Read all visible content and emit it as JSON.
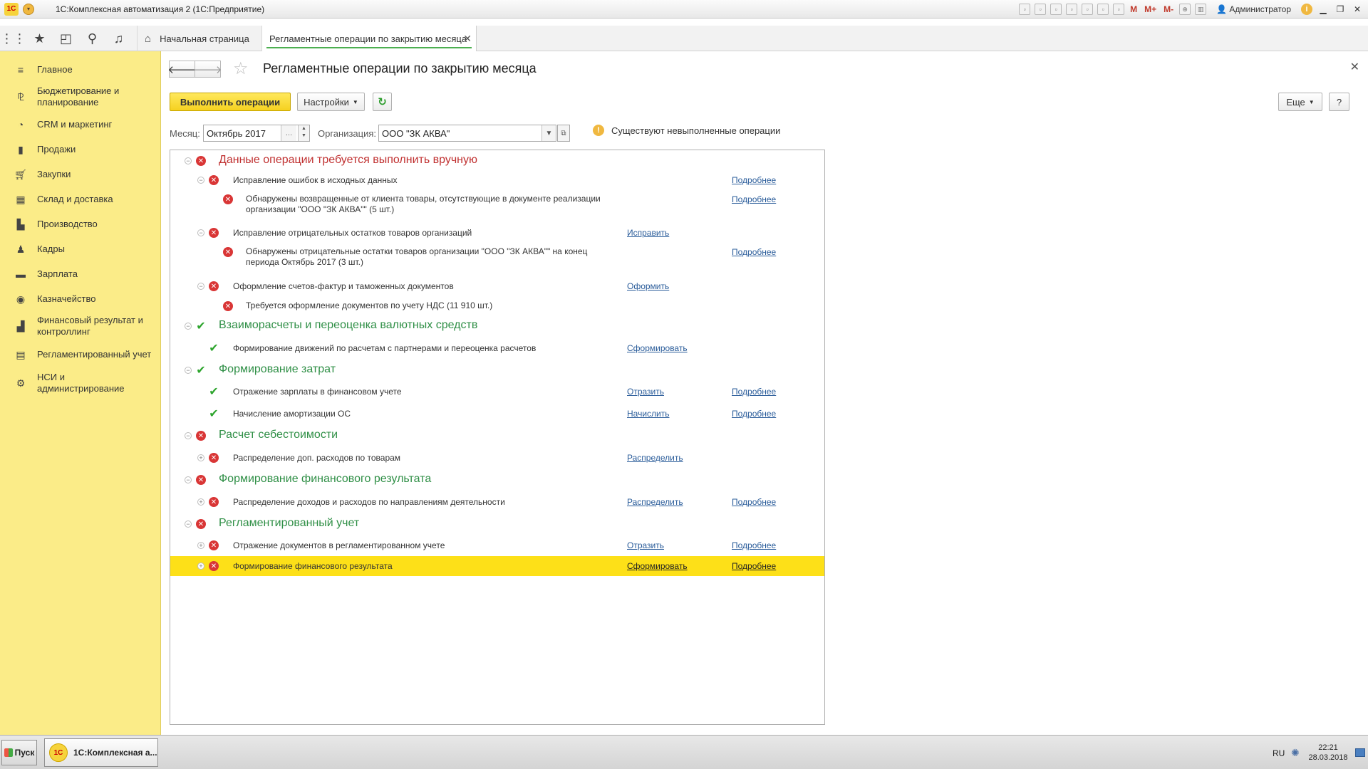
{
  "window": {
    "logo": "1С",
    "title": "1С:Комплексная автоматизация 2  (1С:Предприятие)",
    "user": "Администратор",
    "toolbar_m": [
      "M",
      "M+",
      "M-"
    ]
  },
  "nav": {
    "icons": [
      "apps-grid-icon",
      "star-icon",
      "history-icon",
      "search-icon",
      "bell-icon"
    ],
    "home_tab": "Начальная страница",
    "active_tab": "Регламентные операции по закрытию месяца"
  },
  "sidebar": {
    "items": [
      {
        "label": "Главное",
        "icon": "menu-icon"
      },
      {
        "label": "Бюджетирование и планирование",
        "icon": "budget-icon"
      },
      {
        "label": "CRM и маркетинг",
        "icon": "crm-icon"
      },
      {
        "label": "Продажи",
        "icon": "sales-icon"
      },
      {
        "label": "Закупки",
        "icon": "cart-icon"
      },
      {
        "label": "Склад и доставка",
        "icon": "warehouse-icon"
      },
      {
        "label": "Производство",
        "icon": "production-icon"
      },
      {
        "label": "Кадры",
        "icon": "person-icon"
      },
      {
        "label": "Зарплата",
        "icon": "salary-icon"
      },
      {
        "label": "Казначейство",
        "icon": "treasury-icon"
      },
      {
        "label": "Финансовый результат и контроллинг",
        "icon": "chart-icon"
      },
      {
        "label": "Регламентированный учет",
        "icon": "ledger-icon"
      },
      {
        "label": "НСИ и администрирование",
        "icon": "gear-icon"
      }
    ]
  },
  "form": {
    "title": "Регламентные операции по закрытию месяца",
    "execute_label": "Выполнить операции",
    "settings_label": "Настройки",
    "more_label": "Еще",
    "help_label": "?",
    "month_label": "Месяц:",
    "month_value": "Октябрь 2017",
    "org_label": "Организация:",
    "org_value": "ООО \"ЗК АКВА\"",
    "warning_text": "Существуют невыполненные операции"
  },
  "tree": {
    "rows": [
      {
        "level": 1,
        "status": "error",
        "toggle": "collapse",
        "text": "Данные операции требуется выполнить вручную",
        "color": "red"
      },
      {
        "level": 2,
        "status": "error",
        "toggle": "collapse",
        "text": "Исправление ошибок в исходных данных",
        "action": "",
        "details": "Подробнее"
      },
      {
        "level": 3,
        "status": "error",
        "text": "Обнаружены возвращенные от клиента товары, отсутствующие в документе реализации организации \"ООО \"ЗК АКВА\"\" (5 шт.)",
        "action": "",
        "details": "Подробнее"
      },
      {
        "level": 2,
        "status": "error",
        "toggle": "collapse",
        "text": "Исправление отрицательных остатков товаров организаций",
        "action": "Исправить",
        "details": ""
      },
      {
        "level": 3,
        "status": "error",
        "text": "Обнаружены отрицательные остатки товаров организации \"ООО \"ЗК АКВА\"\" на конец периода Октябрь 2017 (3 шт.)",
        "action": "",
        "details": "Подробнее"
      },
      {
        "level": 2,
        "status": "error",
        "toggle": "collapse",
        "text": "Оформление счетов-фактур и таможенных документов",
        "action": "Оформить",
        "details": ""
      },
      {
        "level": 3,
        "status": "error",
        "text": "Требуется оформление документов по учету НДС (11 910 шт.)",
        "action": "",
        "details": ""
      },
      {
        "level": 1,
        "status": "ok",
        "toggle": "collapse",
        "text": "Взаиморасчеты и переоценка валютных средств",
        "color": "green"
      },
      {
        "level": 2,
        "status": "ok",
        "text": "Формирование движений по расчетам с партнерами и переоценка расчетов",
        "action": "Сформировать",
        "details": ""
      },
      {
        "level": 1,
        "status": "ok",
        "toggle": "collapse",
        "text": "Формирование затрат",
        "color": "green"
      },
      {
        "level": 2,
        "status": "ok",
        "text": "Отражение зарплаты в финансовом учете",
        "action": "Отразить",
        "details": "Подробнее"
      },
      {
        "level": 2,
        "status": "ok",
        "text": "Начисление амортизации ОС",
        "action": "Начислить",
        "details": "Подробнее"
      },
      {
        "level": 1,
        "status": "error",
        "toggle": "collapse",
        "text": "Расчет себестоимости",
        "color": "green"
      },
      {
        "level": 2,
        "status": "error",
        "toggle": "expand",
        "text": "Распределение доп. расходов по товарам",
        "action": "Распределить",
        "details": ""
      },
      {
        "level": 1,
        "status": "error",
        "toggle": "collapse",
        "text": "Формирование финансового результата",
        "color": "green"
      },
      {
        "level": 2,
        "status": "error",
        "toggle": "expand",
        "text": "Распределение доходов и расходов по направлениям деятельности",
        "action": "Распределить",
        "details": "Подробнее"
      },
      {
        "level": 1,
        "status": "error",
        "toggle": "collapse",
        "text": "Регламентированный учет",
        "color": "green"
      },
      {
        "level": 2,
        "status": "error",
        "toggle": "expand",
        "text": "Отражение документов в регламентированном учете",
        "action": "Отразить",
        "details": "Подробнее"
      },
      {
        "level": 2,
        "status": "error",
        "toggle": "expand",
        "text": "Формирование финансового результата",
        "action": "Сформировать",
        "details": "Подробнее",
        "selected": true
      }
    ]
  },
  "taskbar": {
    "start_label": "Пуск",
    "app_label": "1С:Комплексная а...",
    "lang": "RU",
    "time": "22:21",
    "date": "28.03.2018"
  },
  "colors": {
    "sidebar_bg": "#fbec88",
    "primary_button": "#f5d120",
    "selected_row": "#fde018",
    "error": "#d93636",
    "ok": "#2ea52e",
    "link": "#2a5c9a"
  }
}
